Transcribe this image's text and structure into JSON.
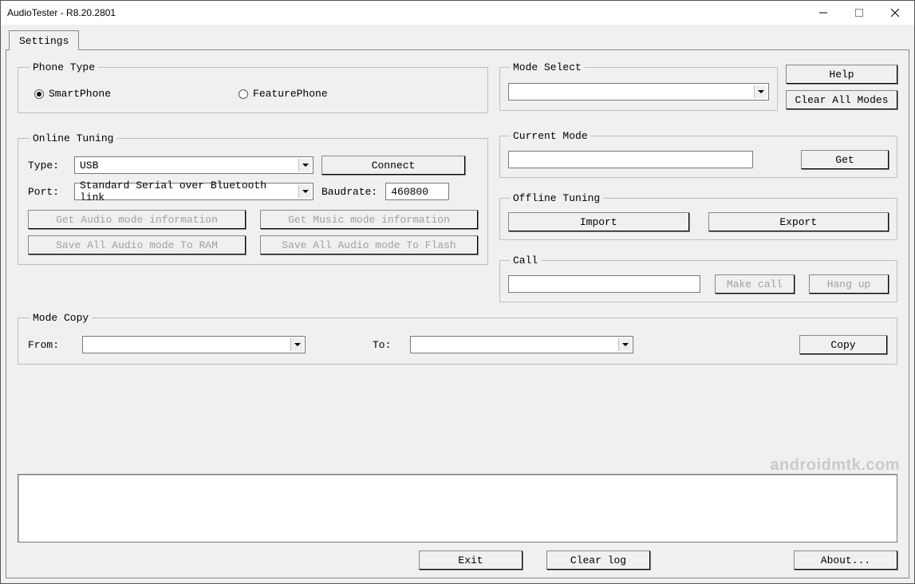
{
  "window": {
    "title": "AudioTester - R8.20.2801"
  },
  "tabs": {
    "settings": "Settings"
  },
  "phone_type": {
    "legend": "Phone Type",
    "smartphone": "SmartPhone",
    "featurephone": "FeaturePhone"
  },
  "online_tuning": {
    "legend": "Online Tuning",
    "type_label": "Type:",
    "type_value": "USB",
    "connect": "Connect",
    "port_label": "Port:",
    "port_value": "Standard Serial over Bluetooth link",
    "baud_label": "Baudrate:",
    "baud_value": "460800",
    "get_audio_info": "Get Audio mode information",
    "get_music_info": "Get Music mode information",
    "save_ram": "Save All Audio mode To RAM",
    "save_flash": "Save All Audio mode To Flash"
  },
  "mode_select": {
    "legend": "Mode Select",
    "value": ""
  },
  "help_button": "Help",
  "clear_all_modes": "Clear All Modes",
  "current_mode": {
    "legend": "Current Mode",
    "value": "",
    "get": "Get"
  },
  "offline_tuning": {
    "legend": "Offline Tuning",
    "import": "Import",
    "export": "Export"
  },
  "call": {
    "legend": "Call",
    "value": "",
    "make_call": "Make call",
    "hang_up": "Hang up"
  },
  "mode_copy": {
    "legend": "Mode Copy",
    "from_label": "From:",
    "from_value": "",
    "to_label": "To:",
    "to_value": "",
    "copy": "Copy"
  },
  "bottom": {
    "exit": "Exit",
    "clear_log": "Clear log",
    "about": "About..."
  },
  "watermark": "androidmtk.com"
}
